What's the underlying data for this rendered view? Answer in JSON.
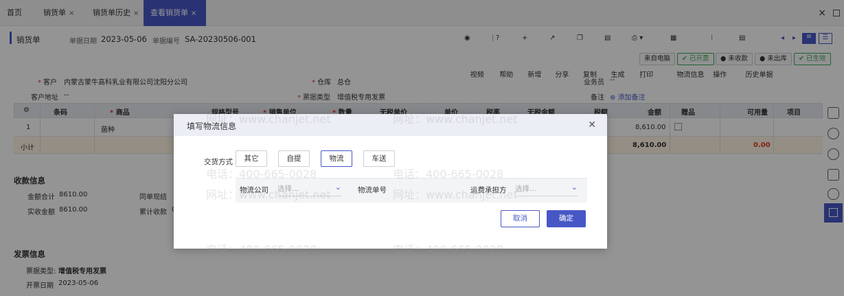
{
  "tabs": [
    {
      "label": "首页"
    },
    {
      "label": "销货单"
    },
    {
      "label": "销货单历史"
    },
    {
      "label": "查看销货单"
    }
  ],
  "close_window_glyph": "×",
  "tab_close_glyph": "×",
  "header": {
    "doc_type": "销货单",
    "date_label": "单据日期",
    "date_value": "2023-05-06",
    "code_label": "单据编号",
    "code_value": "SA-20230506-001"
  },
  "actions": [
    "视频",
    "帮助",
    "新增",
    "分享",
    "复制",
    "生成",
    "打印",
    "物流信息",
    "操作",
    "历史单据"
  ],
  "status_badges": [
    "来自电脑",
    "已开票",
    "未收款",
    "未出库",
    "已生效"
  ],
  "form": {
    "customer_label": "客户",
    "customer_value": "内蒙古蒙牛高科乳业有限公司沈阳分公司",
    "warehouse_label": "仓库",
    "warehouse_value": "总仓",
    "salesman_label": "业务员",
    "salesman_value": "--",
    "address_label": "客户地址",
    "address_value": "--",
    "invoice_type_label": "票据类型",
    "invoice_type_value": "增值税专用发票",
    "remark_label": "备注",
    "add_remark": "添加备注"
  },
  "table": {
    "headers": [
      "条码",
      "商品",
      "规格型号",
      "销售单位",
      "数量",
      "无税单价",
      "单价",
      "税率",
      "无税金额",
      "税额",
      "金额",
      "赠品",
      "可用量",
      "项目"
    ],
    "row": {
      "index": "1",
      "product": "菌种",
      "amount": "8,610.00"
    },
    "subtotal": {
      "label": "小计",
      "amount": "8,610.00",
      "available": "0.00"
    }
  },
  "receipt": {
    "title": "收款信息",
    "total_label": "金额合计",
    "total_value": "8610.00",
    "paid_label": "实收金额",
    "paid_value": "8610.00",
    "same_label": "同单现结",
    "cum_label": "累计收款",
    "cum_value": "0"
  },
  "invoice": {
    "title": "发票信息",
    "type_label": "票据类型:",
    "type_value": "增值税专用发票",
    "date_label": "开票日期",
    "date_value": "2023-05-06"
  },
  "dialog": {
    "title": "填写物流信息",
    "delivery_label": "交货方式",
    "modes": [
      "其它",
      "自提",
      "物流",
      "车送"
    ],
    "selected_mode": "物流",
    "company_label": "物流公司",
    "company_placeholder": "选择...",
    "tracking_label": "物流单号",
    "fee_label": "运费承担方",
    "fee_placeholder": "选择...",
    "cancel_label": "取消",
    "ok_label": "确定"
  },
  "watermark": {
    "phone": "电话：400-665-0028",
    "site": "网址：www.chanjet.net"
  },
  "colors": {
    "accent": "#4758c6",
    "status_green": "#3aa85a",
    "subtotal_red": "#e33b1f"
  }
}
